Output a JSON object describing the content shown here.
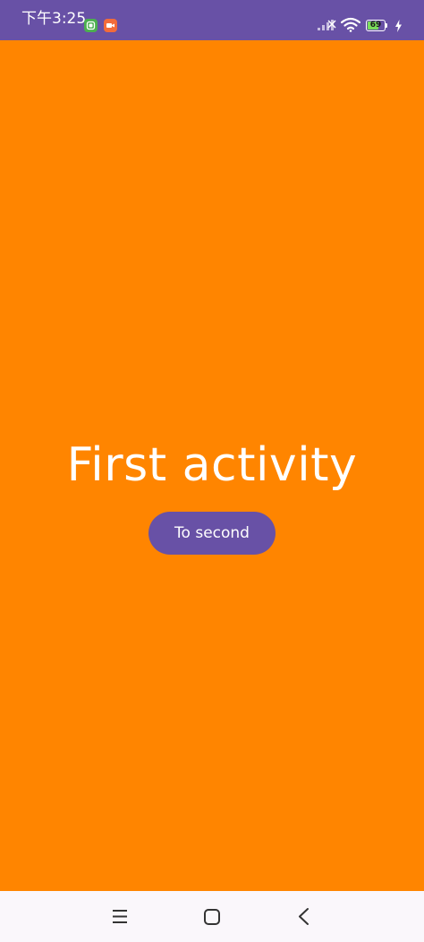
{
  "status_bar": {
    "time": "下午3:25",
    "battery_level": "69",
    "battery_fraction": 0.69,
    "background_color": "#6851A6",
    "notification_icons": [
      "app-notification-icon",
      "screen-recorder-icon"
    ],
    "system_icons": [
      "cellular-signal-icon",
      "wifi-icon",
      "battery-icon",
      "charging-icon"
    ]
  },
  "main": {
    "background_color": "#FF8500",
    "title": "First activity",
    "button_label": "To second",
    "button_color": "#6851A6"
  },
  "nav_bar": {
    "items": [
      "menu-icon",
      "home-icon",
      "back-icon"
    ]
  }
}
